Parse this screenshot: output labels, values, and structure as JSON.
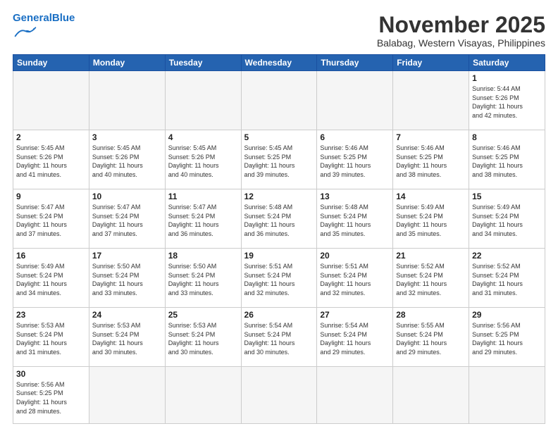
{
  "header": {
    "logo_general": "General",
    "logo_blue": "Blue",
    "month_title": "November 2025",
    "subtitle": "Balabag, Western Visayas, Philippines"
  },
  "days_of_week": [
    "Sunday",
    "Monday",
    "Tuesday",
    "Wednesday",
    "Thursday",
    "Friday",
    "Saturday"
  ],
  "weeks": [
    [
      {
        "day": "",
        "info": ""
      },
      {
        "day": "",
        "info": ""
      },
      {
        "day": "",
        "info": ""
      },
      {
        "day": "",
        "info": ""
      },
      {
        "day": "",
        "info": ""
      },
      {
        "day": "",
        "info": ""
      },
      {
        "day": "1",
        "info": "Sunrise: 5:44 AM\nSunset: 5:26 PM\nDaylight: 11 hours\nand 42 minutes."
      }
    ],
    [
      {
        "day": "2",
        "info": "Sunrise: 5:45 AM\nSunset: 5:26 PM\nDaylight: 11 hours\nand 41 minutes."
      },
      {
        "day": "3",
        "info": "Sunrise: 5:45 AM\nSunset: 5:26 PM\nDaylight: 11 hours\nand 40 minutes."
      },
      {
        "day": "4",
        "info": "Sunrise: 5:45 AM\nSunset: 5:26 PM\nDaylight: 11 hours\nand 40 minutes."
      },
      {
        "day": "5",
        "info": "Sunrise: 5:45 AM\nSunset: 5:25 PM\nDaylight: 11 hours\nand 39 minutes."
      },
      {
        "day": "6",
        "info": "Sunrise: 5:46 AM\nSunset: 5:25 PM\nDaylight: 11 hours\nand 39 minutes."
      },
      {
        "day": "7",
        "info": "Sunrise: 5:46 AM\nSunset: 5:25 PM\nDaylight: 11 hours\nand 38 minutes."
      },
      {
        "day": "8",
        "info": "Sunrise: 5:46 AM\nSunset: 5:25 PM\nDaylight: 11 hours\nand 38 minutes."
      }
    ],
    [
      {
        "day": "9",
        "info": "Sunrise: 5:47 AM\nSunset: 5:24 PM\nDaylight: 11 hours\nand 37 minutes."
      },
      {
        "day": "10",
        "info": "Sunrise: 5:47 AM\nSunset: 5:24 PM\nDaylight: 11 hours\nand 37 minutes."
      },
      {
        "day": "11",
        "info": "Sunrise: 5:47 AM\nSunset: 5:24 PM\nDaylight: 11 hours\nand 36 minutes."
      },
      {
        "day": "12",
        "info": "Sunrise: 5:48 AM\nSunset: 5:24 PM\nDaylight: 11 hours\nand 36 minutes."
      },
      {
        "day": "13",
        "info": "Sunrise: 5:48 AM\nSunset: 5:24 PM\nDaylight: 11 hours\nand 35 minutes."
      },
      {
        "day": "14",
        "info": "Sunrise: 5:49 AM\nSunset: 5:24 PM\nDaylight: 11 hours\nand 35 minutes."
      },
      {
        "day": "15",
        "info": "Sunrise: 5:49 AM\nSunset: 5:24 PM\nDaylight: 11 hours\nand 34 minutes."
      }
    ],
    [
      {
        "day": "16",
        "info": "Sunrise: 5:49 AM\nSunset: 5:24 PM\nDaylight: 11 hours\nand 34 minutes."
      },
      {
        "day": "17",
        "info": "Sunrise: 5:50 AM\nSunset: 5:24 PM\nDaylight: 11 hours\nand 33 minutes."
      },
      {
        "day": "18",
        "info": "Sunrise: 5:50 AM\nSunset: 5:24 PM\nDaylight: 11 hours\nand 33 minutes."
      },
      {
        "day": "19",
        "info": "Sunrise: 5:51 AM\nSunset: 5:24 PM\nDaylight: 11 hours\nand 32 minutes."
      },
      {
        "day": "20",
        "info": "Sunrise: 5:51 AM\nSunset: 5:24 PM\nDaylight: 11 hours\nand 32 minutes."
      },
      {
        "day": "21",
        "info": "Sunrise: 5:52 AM\nSunset: 5:24 PM\nDaylight: 11 hours\nand 32 minutes."
      },
      {
        "day": "22",
        "info": "Sunrise: 5:52 AM\nSunset: 5:24 PM\nDaylight: 11 hours\nand 31 minutes."
      }
    ],
    [
      {
        "day": "23",
        "info": "Sunrise: 5:53 AM\nSunset: 5:24 PM\nDaylight: 11 hours\nand 31 minutes."
      },
      {
        "day": "24",
        "info": "Sunrise: 5:53 AM\nSunset: 5:24 PM\nDaylight: 11 hours\nand 30 minutes."
      },
      {
        "day": "25",
        "info": "Sunrise: 5:53 AM\nSunset: 5:24 PM\nDaylight: 11 hours\nand 30 minutes."
      },
      {
        "day": "26",
        "info": "Sunrise: 5:54 AM\nSunset: 5:24 PM\nDaylight: 11 hours\nand 30 minutes."
      },
      {
        "day": "27",
        "info": "Sunrise: 5:54 AM\nSunset: 5:24 PM\nDaylight: 11 hours\nand 29 minutes."
      },
      {
        "day": "28",
        "info": "Sunrise: 5:55 AM\nSunset: 5:24 PM\nDaylight: 11 hours\nand 29 minutes."
      },
      {
        "day": "29",
        "info": "Sunrise: 5:56 AM\nSunset: 5:25 PM\nDaylight: 11 hours\nand 29 minutes."
      }
    ],
    [
      {
        "day": "30",
        "info": "Sunrise: 5:56 AM\nSunset: 5:25 PM\nDaylight: 11 hours\nand 28 minutes."
      },
      {
        "day": "",
        "info": ""
      },
      {
        "day": "",
        "info": ""
      },
      {
        "day": "",
        "info": ""
      },
      {
        "day": "",
        "info": ""
      },
      {
        "day": "",
        "info": ""
      },
      {
        "day": "",
        "info": ""
      }
    ]
  ]
}
